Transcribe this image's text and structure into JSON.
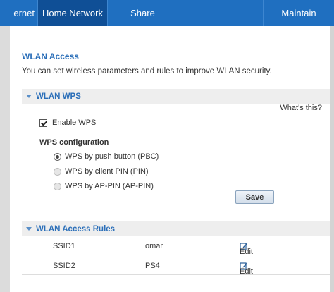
{
  "nav": {
    "tabs": [
      {
        "label": "ernet"
      },
      {
        "label": "Home Network",
        "active": true
      },
      {
        "label": "Share"
      },
      {
        "label": ""
      },
      {
        "label": "Maintain"
      }
    ],
    "active_color": "#0f4f96",
    "bar_color": "#1f6fc0"
  },
  "page": {
    "title": "WLAN Access",
    "description": "You can set wireless parameters and rules to improve WLAN security."
  },
  "wps": {
    "section_title": "WLAN WPS",
    "whats_this": "What's this?",
    "enable_label": "Enable WPS",
    "enable_checked": true,
    "config_label": "WPS configuration",
    "options": [
      {
        "label": "WPS by push button (PBC)",
        "checked": true
      },
      {
        "label": "WPS by client PIN (PIN)",
        "checked": false
      },
      {
        "label": "WPS by AP-PIN (AP-PIN)",
        "checked": false
      }
    ],
    "save_label": "Save"
  },
  "rules": {
    "section_title": "WLAN Access Rules",
    "rows": [
      {
        "ssid": "SSID1",
        "name": "omar",
        "edit": "Edit",
        "icon": "edit-icon"
      },
      {
        "ssid": "SSID2",
        "name": "PS4",
        "edit": "Edit",
        "icon": "edit-icon"
      }
    ]
  }
}
